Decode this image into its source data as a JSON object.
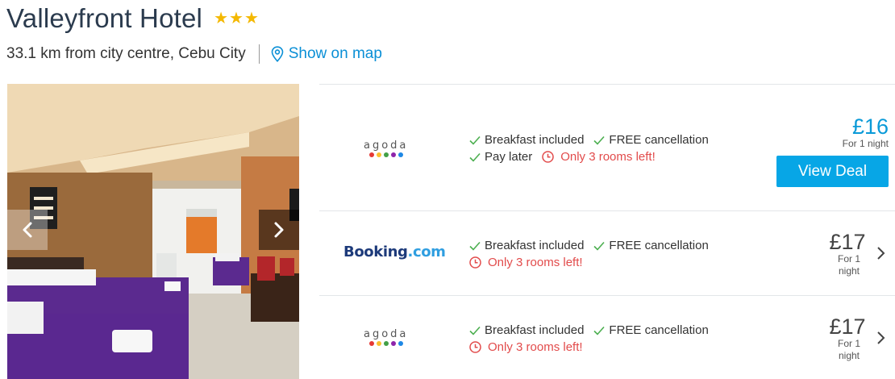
{
  "hotel": {
    "name": "Valleyfront Hotel",
    "star_count": 3,
    "star_color": "#f4b800",
    "distance": "33.1 km from city centre, Cebu City",
    "map_link": "Show on map"
  },
  "photo": {
    "icons": {
      "prev": "chevron-left-icon",
      "next": "chevron-right-icon"
    }
  },
  "deals": [
    {
      "provider": "agoda",
      "features": [
        "Breakfast included",
        "FREE cancellation",
        "Pay later"
      ],
      "warning": "Only 3 rooms left!",
      "price": "£16",
      "price_note": "For 1 night",
      "button_label": "View Deal"
    },
    {
      "provider": "Booking.com",
      "provider_parts": [
        "Booking",
        ".com"
      ],
      "features": [
        "Breakfast included",
        "FREE cancellation"
      ],
      "warning": "Only 3 rooms left!",
      "price": "£17",
      "price_note_line1": "For 1",
      "price_note_line2": "night"
    },
    {
      "provider": "agoda",
      "features": [
        "Breakfast included",
        "FREE cancellation"
      ],
      "warning": "Only 3 rooms left!",
      "price": "£17",
      "price_note_line1": "For 1",
      "price_note_line2": "night"
    }
  ],
  "colors": {
    "accent": "#07a6e6",
    "link": "#0a8fd6",
    "warning": "#e24b4b",
    "check": "#4caf50",
    "agoda_dots": [
      "#e53935",
      "#fbc02d",
      "#43a047",
      "#8e24aa",
      "#1e88e5"
    ]
  }
}
